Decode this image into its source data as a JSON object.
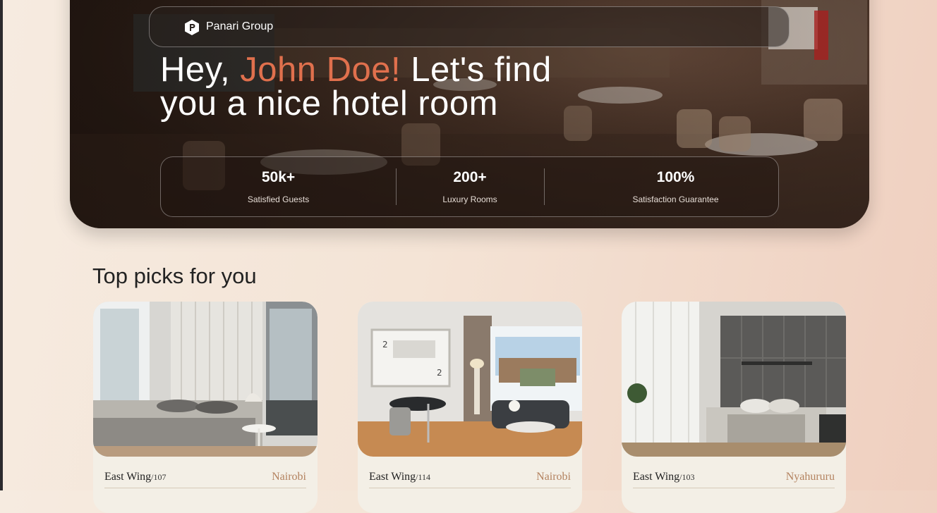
{
  "brand": {
    "name": "Panari Group",
    "logo_icon": "hexagon-p-icon"
  },
  "hero": {
    "greeting": "Hey, ",
    "user_name": "John Doe!",
    "line1_rest": " Let's find",
    "line2": "you a nice hotel room",
    "accent_color": "#e0704d"
  },
  "stats": [
    {
      "value": "50k+",
      "label": "Satisfied Guests"
    },
    {
      "value": "200+",
      "label": "Luxury Rooms"
    },
    {
      "value": "100%",
      "label": "Satisfaction Guarantee"
    }
  ],
  "section": {
    "title": "Top picks for you"
  },
  "rooms": [
    {
      "wing": "East Wing",
      "room": "/107",
      "city": "Nairobi"
    },
    {
      "wing": "East Wing",
      "room": "/114",
      "city": "Nairobi"
    },
    {
      "wing": "East Wing",
      "room": "/103",
      "city": "Nyahururu"
    }
  ]
}
